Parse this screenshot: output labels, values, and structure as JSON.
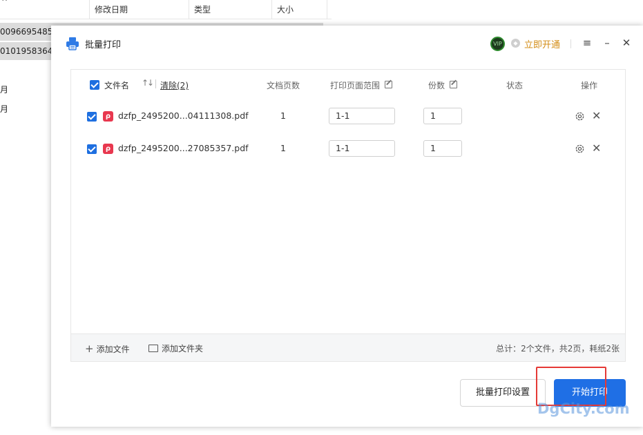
{
  "background_explorer": {
    "columns": [
      "修改日期",
      "类型",
      "大小"
    ],
    "rows": [
      "0096695485_",
      "0101958364_"
    ],
    "months": [
      "月",
      "月"
    ],
    "caret": "^"
  },
  "dialog": {
    "title": "批量打印",
    "vip_badge": "VIP",
    "vip_link": "立即开通",
    "menu_icon": "≡",
    "minimize_icon": "–",
    "close_icon": "✕"
  },
  "table": {
    "headers": {
      "filename": "文件名",
      "clear": "清除(2)",
      "pages": "文档页数",
      "range": "打印页面范围",
      "copies": "份数",
      "status": "状态",
      "actions": "操作"
    },
    "rows": [
      {
        "filename": "dzfp_2495200...04111308.pdf",
        "pages": "1",
        "range": "1-1",
        "copies": "1",
        "status": ""
      },
      {
        "filename": "dzfp_2495200...27085357.pdf",
        "pages": "1",
        "range": "1-1",
        "copies": "1",
        "status": ""
      }
    ]
  },
  "footer": {
    "add_file": "添加文件",
    "add_folder": "添加文件夹",
    "summary": "总计：2个文件，共2页，耗纸2张"
  },
  "buttons": {
    "settings": "批量打印设置",
    "start": "开始打印"
  },
  "watermark": "DgCity.com",
  "colors": {
    "primary": "#1f6fe5",
    "vip": "#d38c14",
    "pdf": "#e8384f",
    "highlight": "#e53935"
  }
}
